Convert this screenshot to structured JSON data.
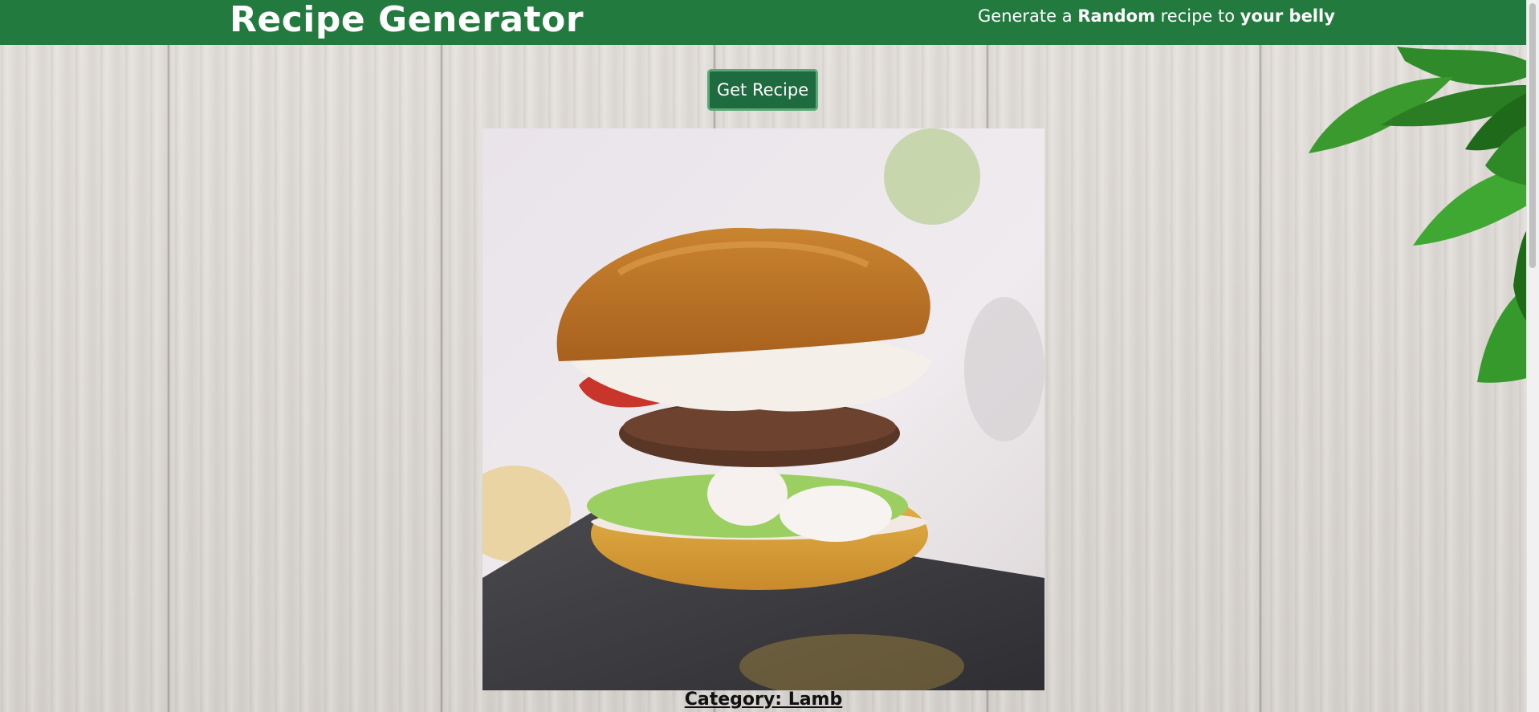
{
  "header": {
    "title": "Recipe Generator",
    "tagline": {
      "part1": "Generate a ",
      "bold1": "Random",
      "part2": " recipe to ",
      "bold2": "your belly"
    }
  },
  "main": {
    "button_label": "Get Recipe",
    "image_alt": "Burger",
    "category_label": "Category: Lamb"
  },
  "colors": {
    "header_bg": "#227a3e",
    "button_bg": "#1e6b3f",
    "button_border": "#5aa873"
  }
}
